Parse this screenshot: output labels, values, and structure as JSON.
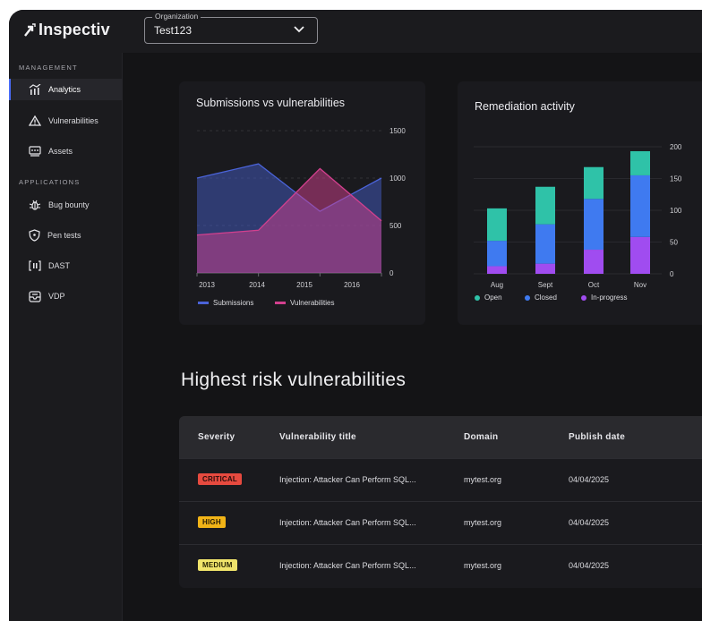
{
  "app": {
    "logo_text": "Inspectiv"
  },
  "org_select": {
    "label": "Organization",
    "value": "Test123"
  },
  "sidebar": {
    "management_title": "MANAGEMENT",
    "applications_title": "APPLICATIONS",
    "items": [
      {
        "label": "Analytics",
        "icon": "analytics-icon"
      },
      {
        "label": "Vulnerabilities",
        "icon": "warning-triangle-icon"
      },
      {
        "label": "Assets",
        "icon": "assets-icon"
      },
      {
        "label": "Bug bounty",
        "icon": "bug-icon"
      },
      {
        "label": "Pen tests",
        "icon": "shield-icon"
      },
      {
        "label": "DAST",
        "icon": "dast-scan-icon"
      },
      {
        "label": "VDP",
        "icon": "vdp-inbox-icon"
      }
    ]
  },
  "chart_data": [
    {
      "type": "area",
      "title": "Submissions vs vulnerabilities",
      "x": [
        "2013",
        "2014",
        "2015",
        "2016"
      ],
      "ylim": [
        0,
        1500
      ],
      "yticks": [
        "1500",
        "1000",
        "500",
        "0"
      ],
      "series": [
        {
          "name": "Submissions",
          "color": "#4a63d8",
          "values": [
            1000,
            1150,
            650,
            1000
          ]
        },
        {
          "name": "Vulnerabilities",
          "color": "#d2408e",
          "values": [
            400,
            450,
            1100,
            550
          ]
        }
      ]
    },
    {
      "type": "bar",
      "stacked": true,
      "title": "Remediation activity",
      "categories": [
        "Aug",
        "Sept",
        "Oct",
        "Nov"
      ],
      "ylim": [
        0,
        200
      ],
      "yticks": [
        "200",
        "150",
        "100",
        "50",
        "0"
      ],
      "series": [
        {
          "name": "In-progress",
          "color": "#a04cf0",
          "values": [
            12,
            16,
            38,
            58
          ]
        },
        {
          "name": "Closed",
          "color": "#3f7af0",
          "values": [
            40,
            62,
            80,
            97
          ]
        },
        {
          "name": "Open",
          "color": "#2fc2a8",
          "values": [
            51,
            59,
            50,
            38
          ]
        }
      ],
      "legend_order": [
        "Open",
        "Closed",
        "In-progress"
      ]
    }
  ],
  "section_title": "Highest risk vulnerabilities",
  "table": {
    "headers": [
      "Severity",
      "Vulnerability title",
      "Domain",
      "Publish date"
    ],
    "rows": [
      {
        "severity": "CRITICAL",
        "title": "Injection: Attacker Can Perform SQL...",
        "domain": "mytest.org",
        "date": "04/04/2025"
      },
      {
        "severity": "HIGH",
        "title": "Injection: Attacker Can Perform SQL...",
        "domain": "mytest.org",
        "date": "04/04/2025"
      },
      {
        "severity": "MEDIUM",
        "title": "Injection: Attacker Can Perform SQL...",
        "domain": "mytest.org",
        "date": "04/04/2025"
      }
    ]
  },
  "colors": {
    "accent": "#4a6cf7",
    "critical": "#e64a3f",
    "high": "#f2b417",
    "medium": "#f0e46b"
  }
}
